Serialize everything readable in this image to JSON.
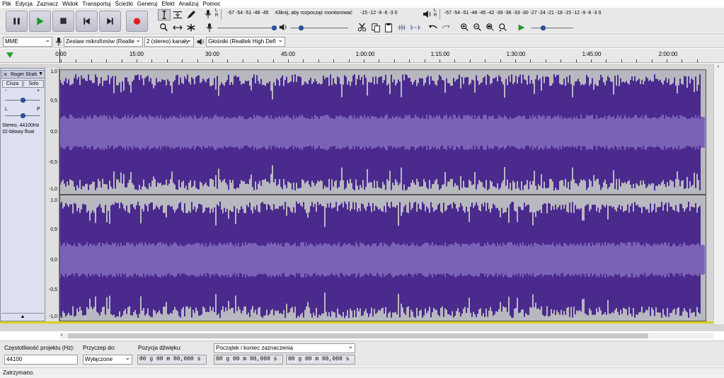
{
  "menu": [
    "Plik",
    "Edycja",
    "Zaznacz",
    "Widok",
    "Transportuj",
    "Ścieżki",
    "Generuj",
    "Efekt",
    "Analizuj",
    "Pomoc"
  ],
  "record_meter": {
    "scale_left": "-57  -54  -51  -48  -45",
    "hint": "Kliknij, aby rozpocząć monitorować",
    "scale_right": "-15  -12  -9   -6   -3   0"
  },
  "playback_meter": {
    "scale": "-57 -54 -51 -48 -45 -42 -39 -36 -33 -30 -27 -24 -21 -18 -15 -12 -9  -6  -3  0"
  },
  "meter_letters": {
    "left": "L",
    "right": "R"
  },
  "devices": {
    "host": "MME",
    "mic": "Zestaw mikrofonów (Realte",
    "channels": "2 (stereo) kanały",
    "speaker": "Głośniki (Realtek High Defi"
  },
  "timeline": [
    "0:00",
    "15:00",
    "30:00",
    "45:00",
    "1:00:00",
    "1:15:00",
    "1:30:00",
    "1:45:00",
    "2:00:00"
  ],
  "track": {
    "name": "Roger Shah",
    "mute": "Cisza",
    "solo": "Solo",
    "gain_minus": "-",
    "gain_plus": "+",
    "pan_left": "L",
    "pan_right": "P",
    "info1": "Stereo, 44100Hz",
    "info2": "32-bitowy float",
    "scale": [
      "1,0",
      "0,5",
      "0,0",
      "-0,5",
      "-1,0"
    ],
    "gain_level": 0.5,
    "pan_level": 0.5
  },
  "selection_bar": {
    "rate_label": "Częstotliwość projektu (Hz):",
    "rate_value": "44100",
    "snap_label": "Przyczep do:",
    "snap_value": "Wyłączone",
    "pos_label": "Pozycja dźwięku:",
    "pos_value": "00 g 00 m 00,000 s",
    "sel_mode": "Początek i koniec zaznaczenia",
    "sel_start": "00 g 00 m 00,000 s",
    "sel_end": "00 g 00 m 00,000 s"
  },
  "status": "Zatrzymano.",
  "colors": {
    "wave": "#4a2a8c",
    "wave_rms": "#7a62b8",
    "bg": "#b8b8c0"
  }
}
